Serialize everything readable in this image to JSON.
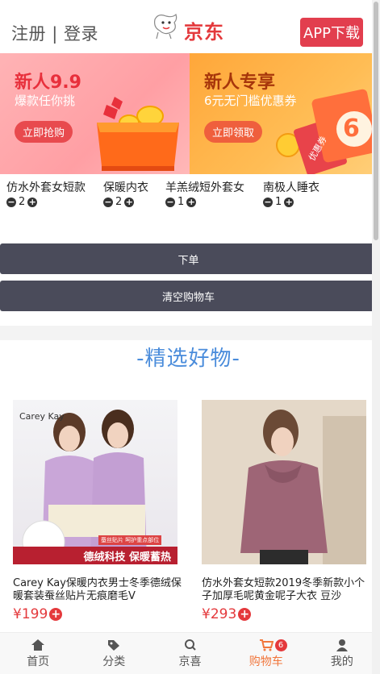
{
  "header": {
    "register": "注册",
    "separator": "|",
    "login": "登录",
    "brand": "京东",
    "app_button": "APP下载"
  },
  "banners": [
    {
      "title": "新人9.9",
      "subtitle": "爆款任你挑",
      "cta": "立即抢购"
    },
    {
      "title": "新人专享",
      "subtitle": "6元无门槛优惠券",
      "cta": "立即领取",
      "coupon_label": "优惠券",
      "coupon_value": "6"
    }
  ],
  "cart_items": [
    {
      "name": "仿水外套女短款",
      "qty": "2"
    },
    {
      "name": "保暖内衣",
      "qty": "2"
    },
    {
      "name": "羊羔绒短外套女",
      "qty": "1"
    },
    {
      "name": "南极人睡衣",
      "qty": "1"
    }
  ],
  "actions": {
    "order": "下单",
    "clear_cart": "清空购物车"
  },
  "section_title": "-精选好物-",
  "products": [
    {
      "title": "Carey Kay保暖内衣男士冬季德绒保暖套装蚕丝贴片无痕磨毛V",
      "price": "¥199",
      "brand_tag": "Carey Kay",
      "promo_strip": "德绒科技 保暖蓄热",
      "promo_small": "蚕丝贴片 呵护重点部位"
    },
    {
      "title": "仿水外套女短款2019冬季新款小个子加厚毛呢黄金呢子大衣 豆沙",
      "price": "¥293"
    }
  ],
  "tabbar": [
    {
      "label": "首页",
      "icon": "home-icon"
    },
    {
      "label": "分类",
      "icon": "tag-icon"
    },
    {
      "label": "京喜",
      "icon": "search-icon"
    },
    {
      "label": "购物车",
      "icon": "cart-icon",
      "badge": "6",
      "active": true
    },
    {
      "label": "我的",
      "icon": "user-icon"
    }
  ],
  "colors": {
    "brand_red": "#e4393c",
    "button_dark": "#4a4b5a",
    "title_blue": "#4a8cdb",
    "active_tab": "#f1773d"
  }
}
